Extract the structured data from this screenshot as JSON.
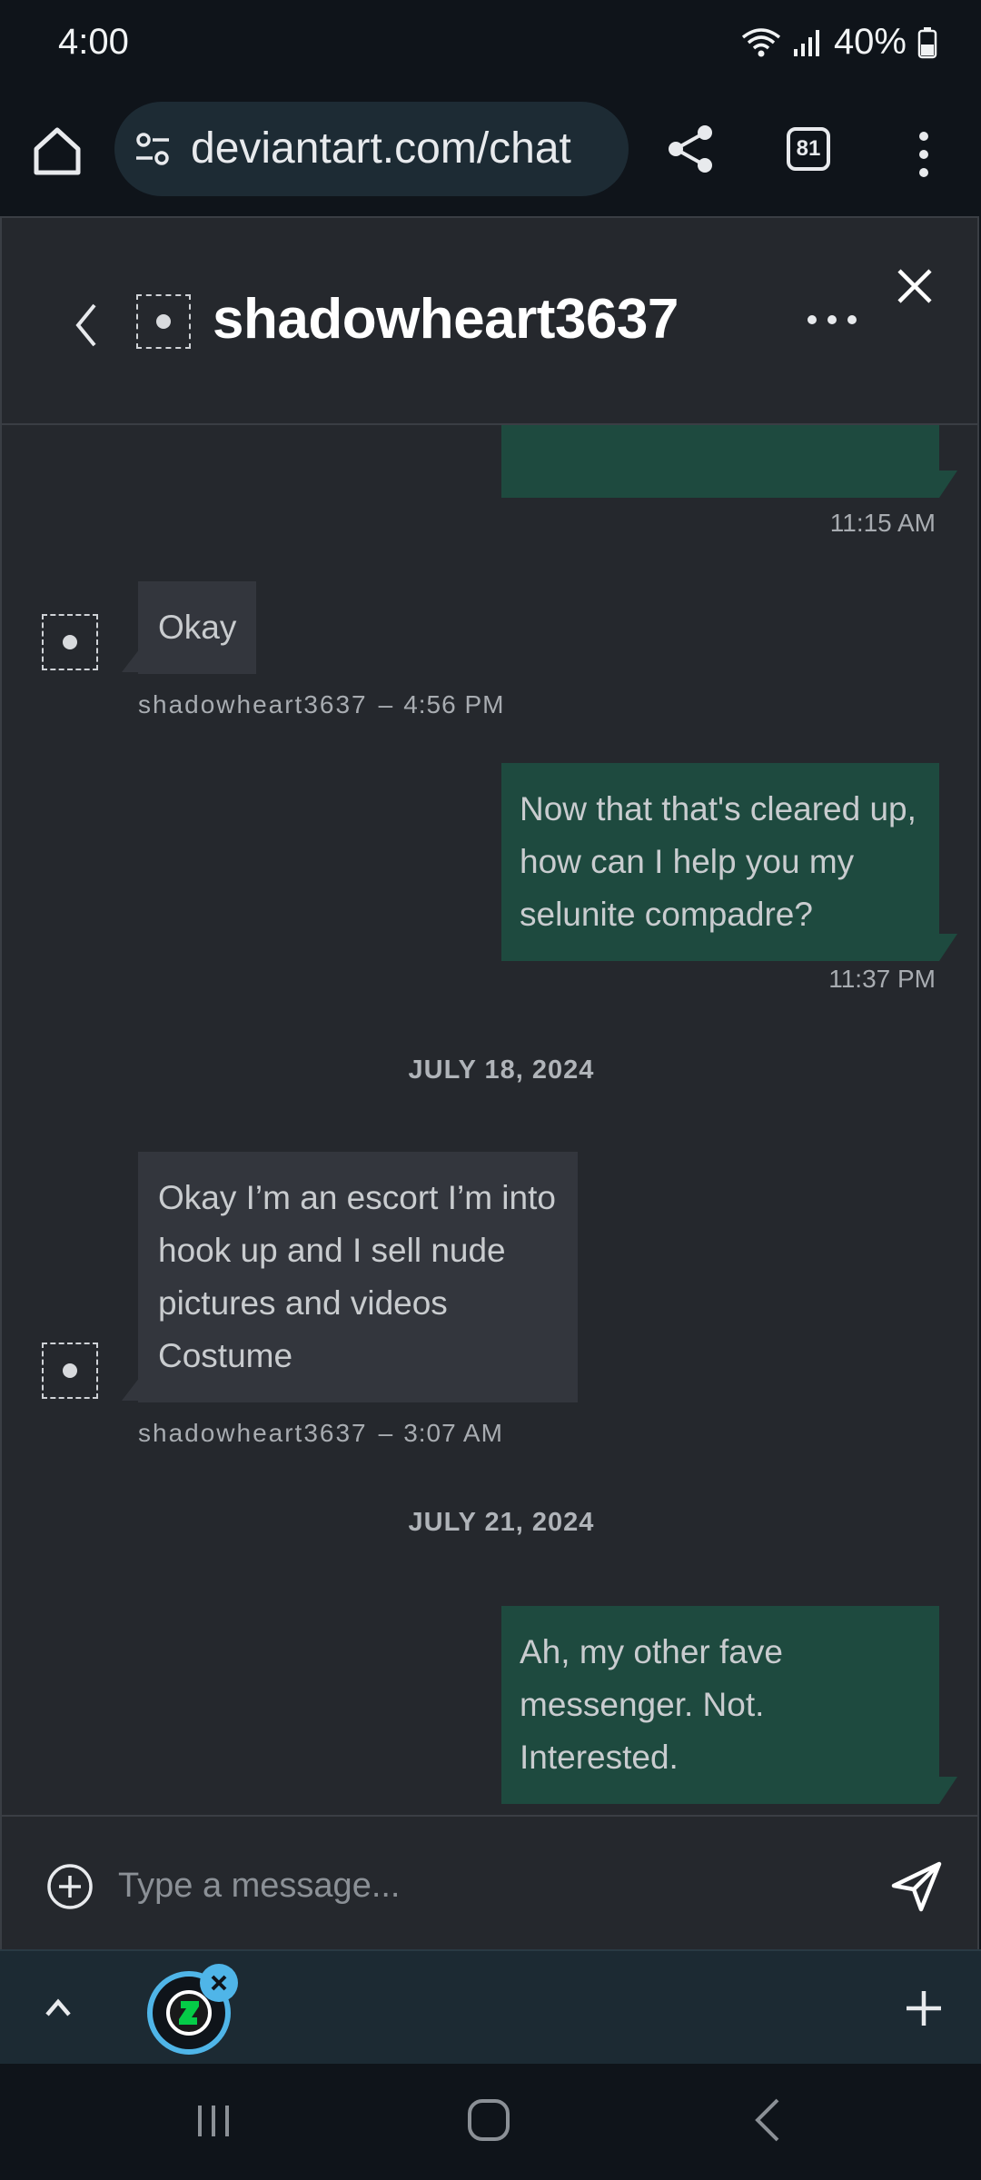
{
  "status_bar": {
    "time": "4:00",
    "battery": "40%"
  },
  "browser": {
    "url": "deviantart.com/chat",
    "tab_count": "81"
  },
  "chat": {
    "title": "shadowheart3637",
    "messages": [
      {
        "from": "me",
        "text": "",
        "time": "11:15 AM"
      },
      {
        "from": "them",
        "text": "Okay",
        "user": "shadowheart3637",
        "sep": "–",
        "time": "4:56 PM"
      },
      {
        "from": "me",
        "text": "Now that that's cleared up, how can I help you my selunite compadre?",
        "time": "11:37 PM"
      },
      {
        "type": "date",
        "label": "JULY 18, 2024"
      },
      {
        "from": "them",
        "text": "Okay I’m an escort I’m into hook up and I sell nude pictures and videos Costume",
        "user": "shadowheart3637",
        "sep": "–",
        "time": "3:07 AM"
      },
      {
        "type": "date",
        "label": "JULY 21, 2024"
      },
      {
        "from": "me",
        "text": "Ah, my other fave messenger. Not. Interested.",
        "time": ""
      }
    ],
    "composer_placeholder": "Type a message..."
  },
  "icons": {
    "home": "home-icon",
    "tune": "page-info-icon",
    "share": "share-icon",
    "menu": "more-vert-icon",
    "back": "chevron-left-icon",
    "more": "more-horiz-icon",
    "close": "close-icon",
    "add": "add-circle-icon",
    "send": "send-icon",
    "expand": "chevron-up-icon",
    "new_tab": "plus-icon",
    "nav_recents": "recents-icon",
    "nav_home": "nav-home-icon",
    "nav_back": "nav-back-icon"
  },
  "colors": {
    "sent_bubble": "#1e4a3f",
    "received_bubble": "#33363d",
    "accent": "#4fb5e8",
    "chat_bg": "#25282d"
  }
}
